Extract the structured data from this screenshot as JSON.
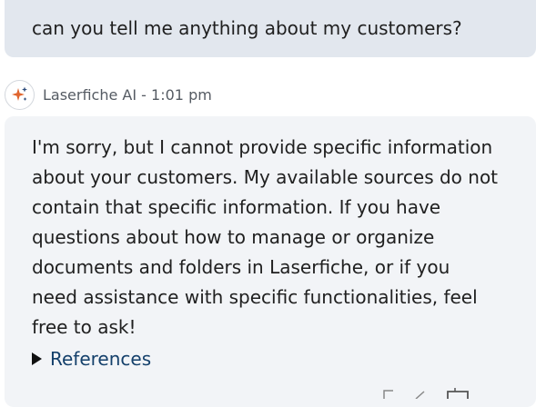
{
  "user_message": {
    "text": "can you tell me anything about my customers?"
  },
  "ai_message": {
    "sender": "Laserfiche AI",
    "separator": " - ",
    "time": "1:01 pm",
    "avatar_icon": "sparkle-icon",
    "text": "I'm sorry, but I cannot provide specific information about your customers. My available sources do not contain that specific information. If you have questions about how to manage or organize documents and folders in Laserfiche, or if you need assistance with specific functionalities, feel free to ask!",
    "references_label": "References"
  },
  "colors": {
    "user_bubble": "#e2e7ee",
    "ai_bubble": "#f2f4f7",
    "link": "#14406b",
    "sparkle_orange": "#e0662f",
    "sparkle_blue": "#2b4a7a"
  },
  "actions": [
    "copy-icon",
    "edit-icon",
    "expand-icon"
  ]
}
